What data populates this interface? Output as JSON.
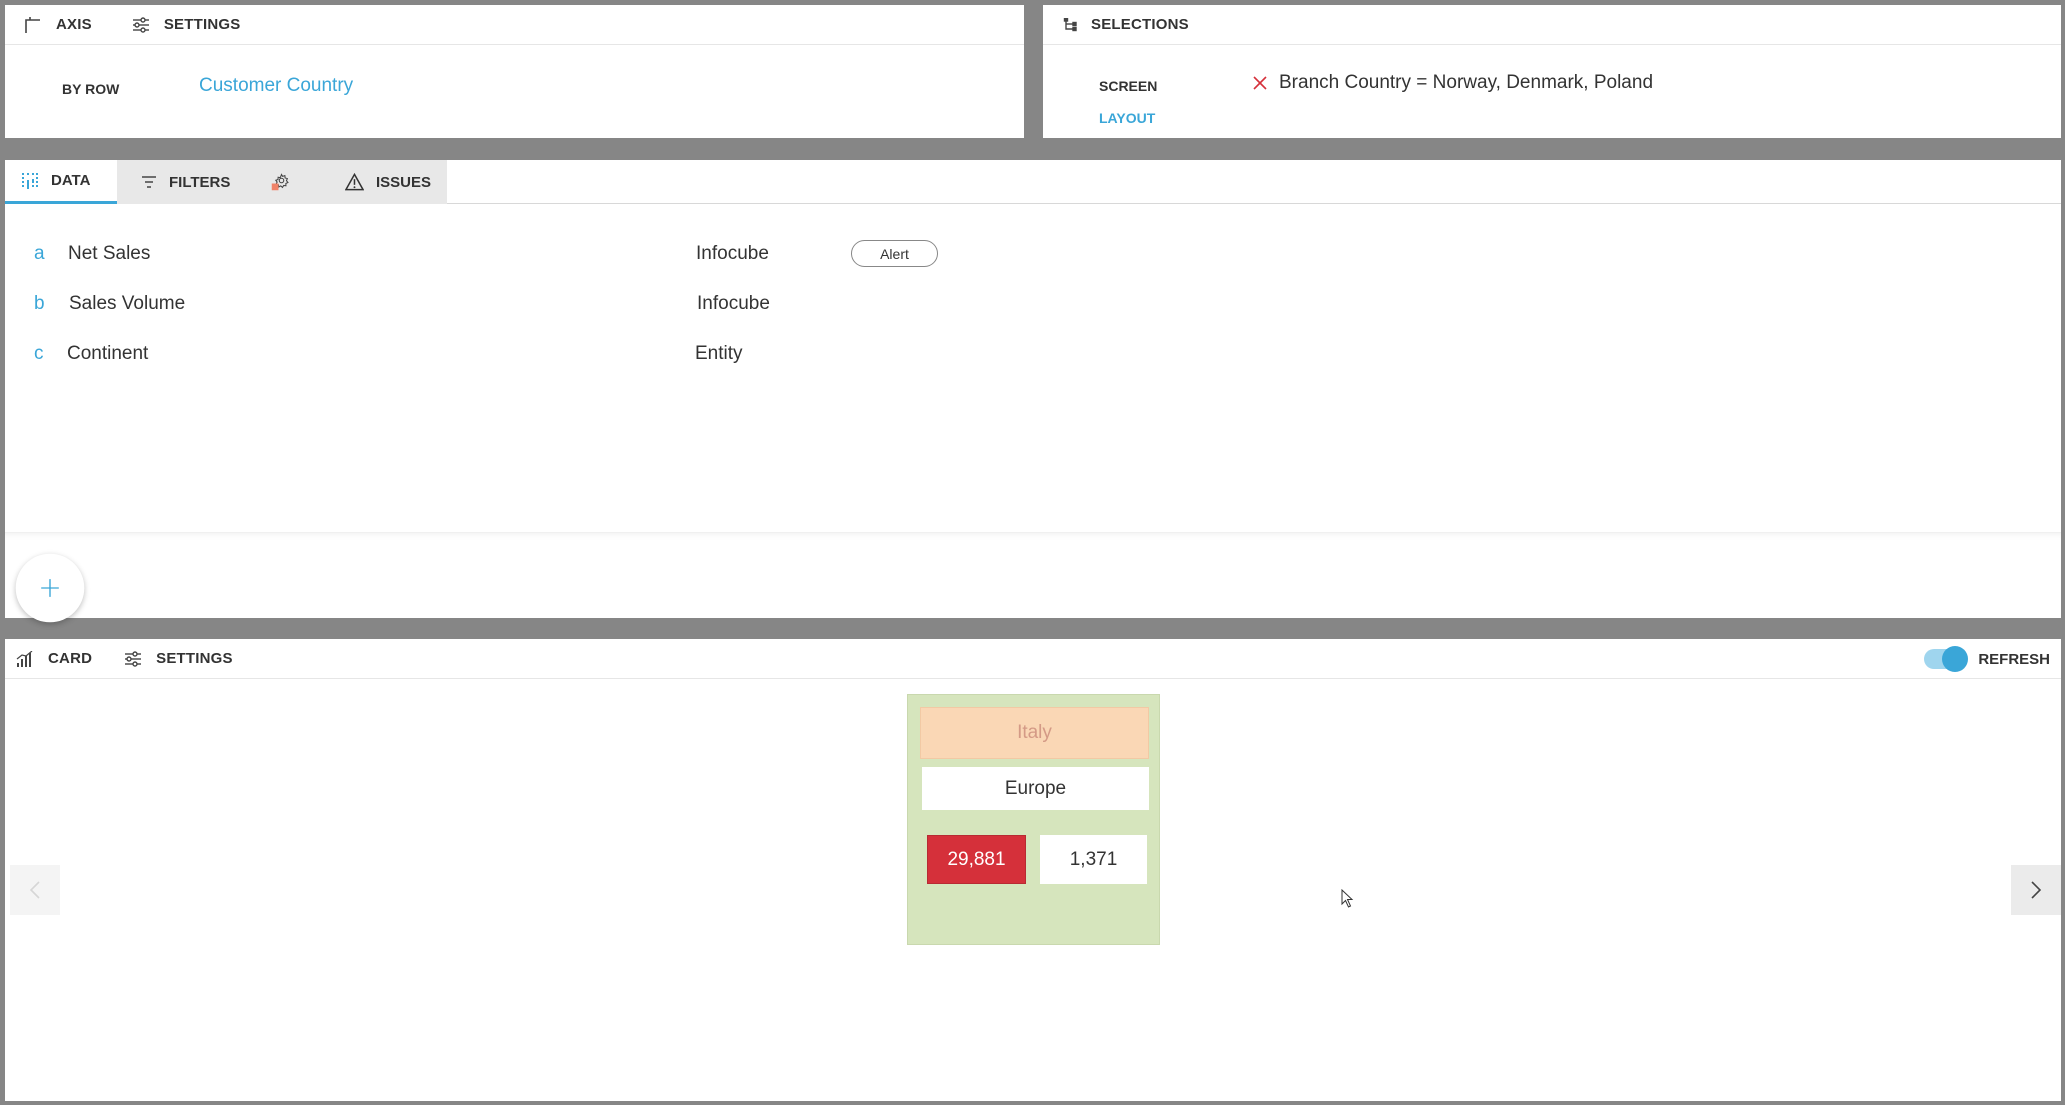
{
  "axis_panel": {
    "axis_label": "AXIS",
    "settings_label": "SETTINGS",
    "by_row_label": "BY ROW",
    "by_row_value": "Customer Country"
  },
  "selections_panel": {
    "title": "SELECTIONS",
    "screen_label": "SCREEN",
    "layout_label": "LAYOUT",
    "selection_text": "Branch Country = Norway, Denmark, Poland"
  },
  "data_panel": {
    "tabs": [
      {
        "label": "DATA",
        "icon": "data-grid-icon"
      },
      {
        "label": "FILTERS",
        "icon": "filter-icon"
      },
      {
        "label": "",
        "icon": "gear-badge-icon"
      },
      {
        "label": "ISSUES",
        "icon": "warning-icon"
      }
    ],
    "rows": [
      {
        "letter": "a",
        "name": "Net Sales",
        "source": "Infocube",
        "action": "Alert"
      },
      {
        "letter": "b",
        "name": "Sales Volume",
        "source": "Infocube"
      },
      {
        "letter": "c",
        "name": "Continent",
        "source": "Entity"
      }
    ],
    "add_icon": "plus-icon"
  },
  "card_panel": {
    "card_label": "CARD",
    "settings_label": "SETTINGS",
    "refresh_label": "REFRESH",
    "refresh_on": true,
    "card": {
      "title": "Italy",
      "subtitle": "Europe",
      "value_1": "29,881",
      "value_2": "1,371"
    }
  },
  "colors": {
    "accent": "#3aa6d8",
    "card_bg": "#d6e5bd",
    "card_title_bg": "#fad7b5",
    "alert_red": "#d5303a",
    "badge_orange": "#f08268"
  }
}
